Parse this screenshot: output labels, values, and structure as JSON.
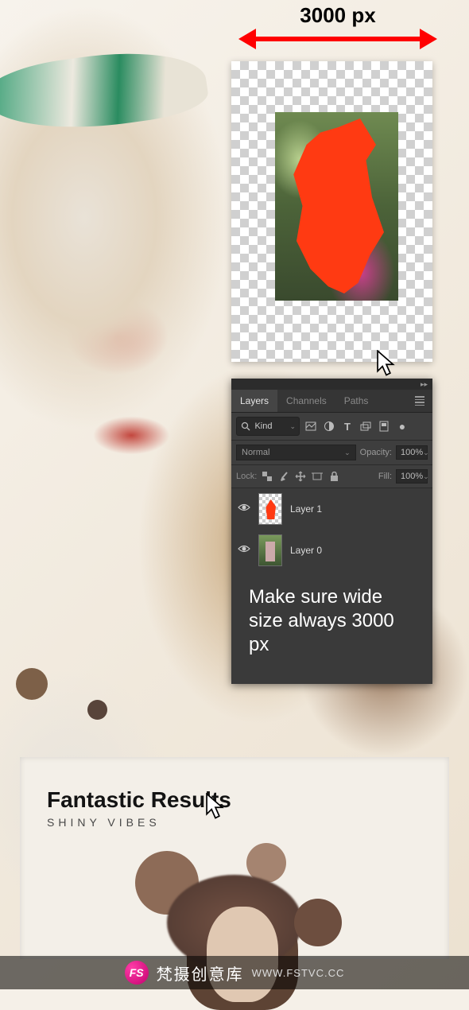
{
  "dimension_label": "3000 px",
  "layers_panel": {
    "tabs": [
      "Layers",
      "Channels",
      "Paths"
    ],
    "active_tab": 0,
    "filter_label": "Kind",
    "blend_mode": "Normal",
    "opacity_label": "Opacity:",
    "opacity_value": "100%",
    "lock_label": "Lock:",
    "fill_label": "Fill:",
    "fill_value": "100%",
    "layers": [
      {
        "name": "Layer 1",
        "visible": true
      },
      {
        "name": "Layer 0",
        "visible": true
      }
    ]
  },
  "instruction_text": "Make sure wide size always 3000 px",
  "bottom": {
    "title": "Fantastic Results",
    "subtitle": "SHINY VIBES"
  },
  "watermark": {
    "badge": "FS",
    "name": "梵摄创意库",
    "url": "WWW.FSTVC.CC"
  }
}
